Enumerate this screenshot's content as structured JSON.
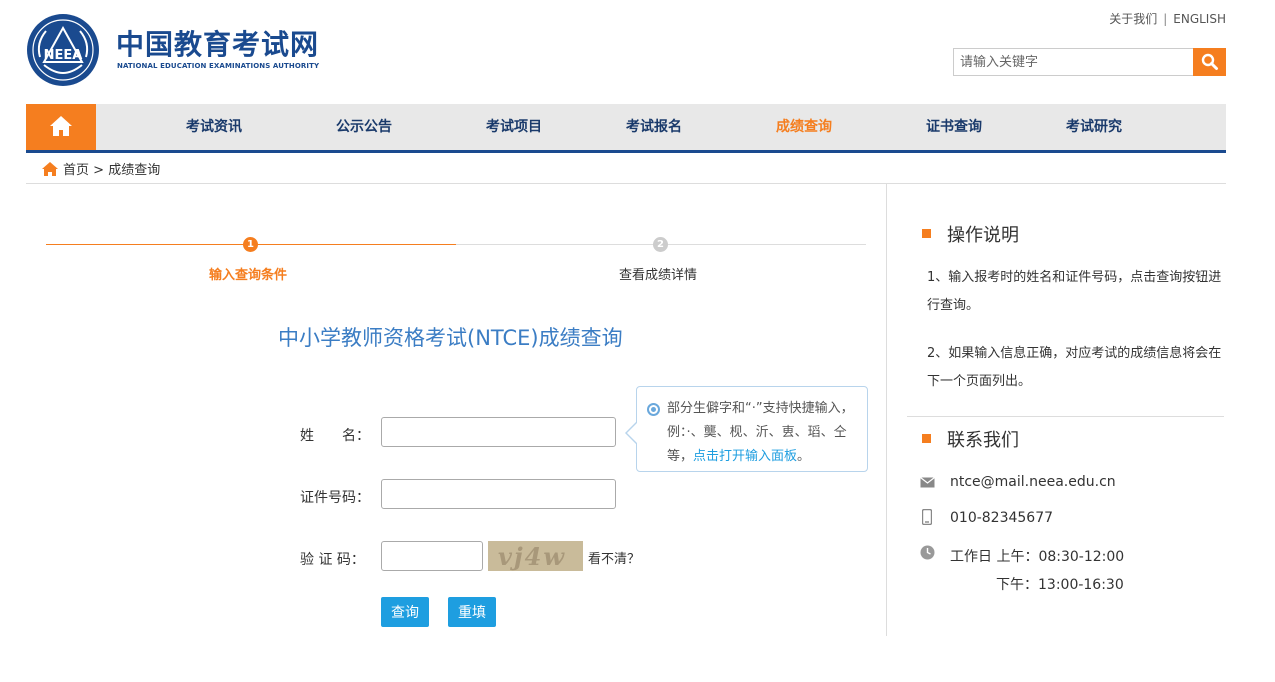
{
  "brand": {
    "name_cn": "中国教育考试网",
    "name_en": "NATIONAL EDUCATION EXAMINATIONS AUTHORITY",
    "emblem_text": "NEEA"
  },
  "toplinks": {
    "about": "关于我们",
    "separator": "|",
    "english": "ENGLISH"
  },
  "search": {
    "placeholder": "请输入关键字",
    "icon": "search-icon"
  },
  "nav": {
    "home_icon": "home-icon",
    "items": [
      {
        "label": "考试资讯"
      },
      {
        "label": "公示公告"
      },
      {
        "label": "考试项目"
      },
      {
        "label": "考试报名"
      },
      {
        "label": "成绩查询",
        "active": true
      },
      {
        "label": "证书查询"
      },
      {
        "label": "考试研究"
      }
    ]
  },
  "breadcrumb": {
    "home": "首页",
    "separator": ">",
    "current": "成绩查询"
  },
  "steps": [
    {
      "number": "1",
      "label": "输入查询条件",
      "active": true
    },
    {
      "number": "2",
      "label": "查看成绩详情",
      "active": false
    }
  ],
  "page_title": "中小学教师资格考试(NTCE)成绩查询",
  "form": {
    "name_label": "姓　　名：",
    "name_value": "",
    "id_label": "证件号码：",
    "id_value": "",
    "captcha_label": "验 证 码：",
    "captcha_value": "",
    "captcha_image_text": "vj4w",
    "refresh_text": "看不清？",
    "submit_label": "查询",
    "reset_label": "重填"
  },
  "tooltip": {
    "text": "部分生僻字和“·”支持快捷输入，例：·、龑、枧、沂、叀、瑫、仝等，",
    "link": "点击打开输入面板",
    "end": "。"
  },
  "sidebar": {
    "instructions_title": "操作说明",
    "instructions": [
      "1、输入报考时的姓名和证件号码，点击查询按钮进行查询。",
      "2、如果输入信息正确，对应考试的成绩信息将会在下一个页面列出。"
    ],
    "contact_title": "联系我们",
    "email": "ntce@mail.neea.edu.cn",
    "phone": "010-82345677",
    "hours_line1": "工作日 上午：08:30-12:00",
    "hours_line2": "下午：13:00-16:30"
  },
  "colors": {
    "brand_blue": "#1a4a8f",
    "accent_orange": "#f57e1f",
    "button_blue": "#1e9ee0",
    "title_blue": "#3b7dc4"
  }
}
